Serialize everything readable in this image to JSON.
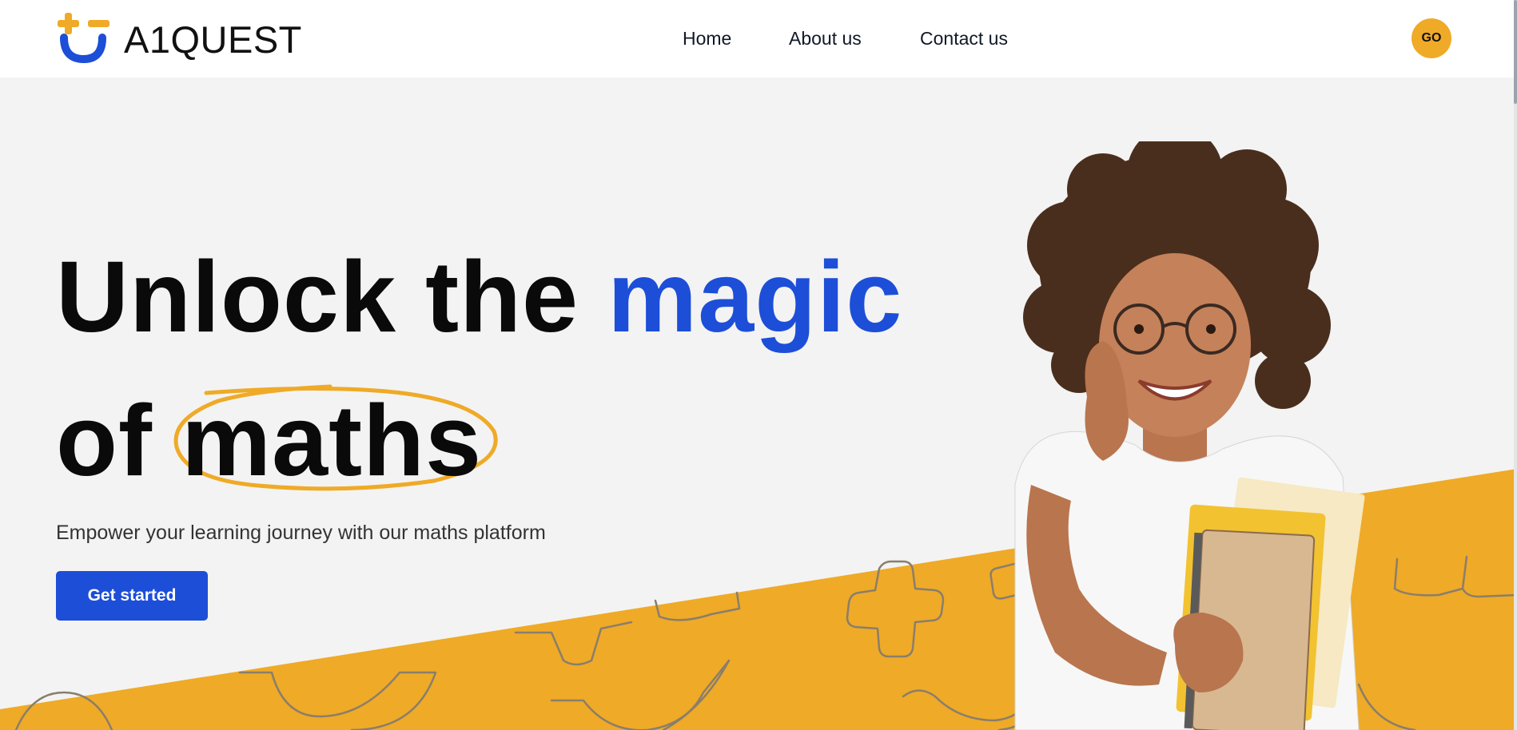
{
  "brand": {
    "name": "A1QUEST",
    "colors": {
      "yellow": "#efaa27",
      "blue": "#1d4ed8",
      "ink": "#0a0a0a"
    }
  },
  "nav": {
    "items": [
      {
        "label": "Home"
      },
      {
        "label": "About us"
      },
      {
        "label": "Contact us"
      }
    ],
    "go_label": "GO"
  },
  "hero": {
    "headline_line1": "Unlock the",
    "headline_accent": "magic",
    "headline_line2_prefix": "of",
    "headline_circled": "maths",
    "subtext": "Empower your learning journey with our maths platform",
    "cta_label": "Get started",
    "illustration": "student-holding-notebooks"
  }
}
